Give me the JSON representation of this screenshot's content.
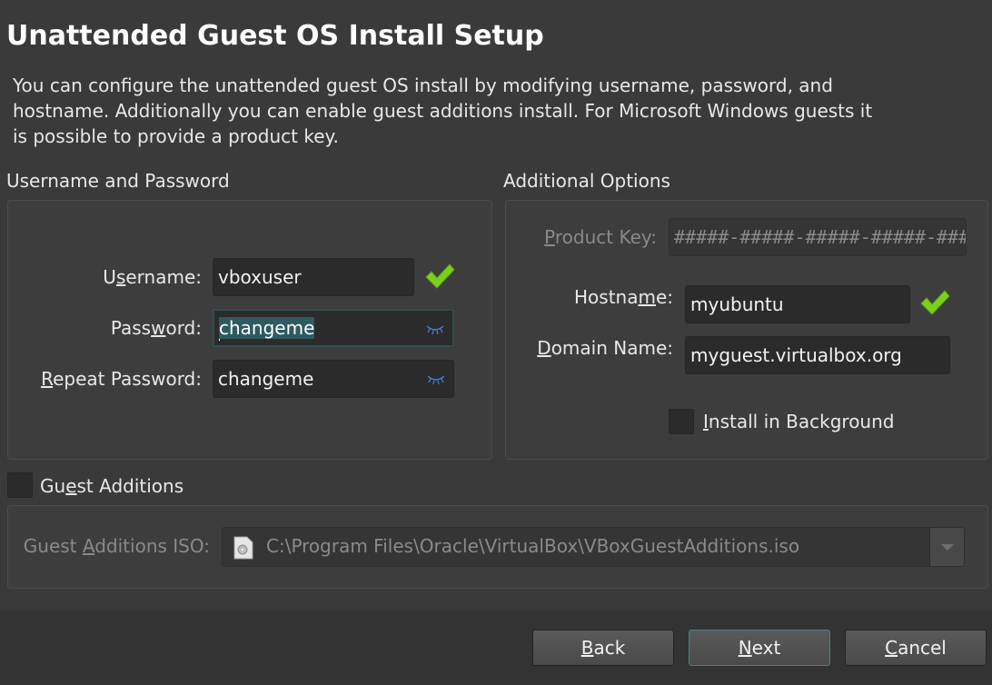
{
  "title": "Unattended Guest OS Install Setup",
  "description": "You can configure the unattended guest OS install by modifying username, password, and hostname. Additionally you can enable guest additions install. For Microsoft Windows guests it is possible to provide a product key.",
  "user_section": {
    "label": "Username and Password",
    "username": {
      "label_pre": "U",
      "label_u": "s",
      "label_post": "ername:",
      "value": "vboxuser"
    },
    "password": {
      "label_pre": "Pass",
      "label_u": "w",
      "label_post": "ord:",
      "value": "changeme"
    },
    "repeat_password": {
      "label_pre": "",
      "label_u": "R",
      "label_post": "epeat Password:",
      "value": "changeme"
    }
  },
  "options_section": {
    "label": "Additional Options",
    "product_key": {
      "label_pre": "",
      "label_u": "P",
      "label_post": "roduct Key:",
      "placeholder": "#####-#####-#####-#####-#####"
    },
    "hostname": {
      "label_pre": "Hostna",
      "label_u": "m",
      "label_post": "e:",
      "value": "myubuntu"
    },
    "domain_name": {
      "label_pre": "",
      "label_u": "D",
      "label_post": "omain Name:",
      "value": "myguest.virtualbox.org"
    },
    "install_background": {
      "label_pre": "",
      "label_u": "I",
      "label_post": "nstall in Background",
      "checked": false
    }
  },
  "guest_additions": {
    "checkbox": {
      "label_pre": "Gu",
      "label_u": "e",
      "label_post": "st Additions",
      "checked": false
    },
    "iso": {
      "label_pre": "Guest ",
      "label_u": "A",
      "label_post": "dditions ISO:",
      "value": "C:\\Program Files\\Oracle\\VirtualBox\\VBoxGuestAdditions.iso"
    }
  },
  "buttons": {
    "back": {
      "label_pre": "",
      "label_u": "B",
      "label_post": "ack"
    },
    "next": {
      "label_pre": "",
      "label_u": "N",
      "label_post": "ext"
    },
    "cancel": {
      "label_pre": "",
      "label_u": "C",
      "label_post": "ancel"
    }
  },
  "colors": {
    "background": "#3a3a3a",
    "valid_check": "#7ccf1c",
    "selection": "#2e5a60",
    "eye_icon": "#4a7fd0"
  },
  "icons": [
    "check-icon",
    "eye-icon",
    "file-icon",
    "chevron-down-icon"
  ]
}
